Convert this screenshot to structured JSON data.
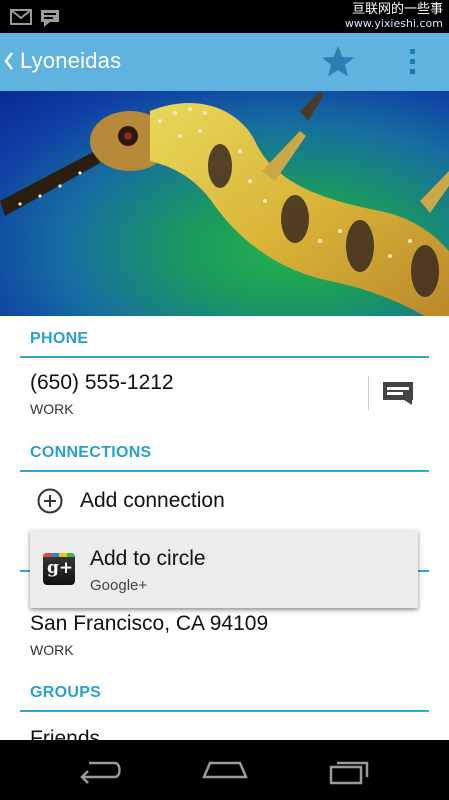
{
  "status_bar": {
    "watermark_line1": "亘联网的一些事",
    "watermark_line2": "www.yixieshi.com"
  },
  "action_bar": {
    "title": "Lyoneidas"
  },
  "phone": {
    "header": "PHONE",
    "number": "(650) 555-1212",
    "type": "WORK"
  },
  "connections": {
    "header": "CONNECTIONS",
    "add_label": "Add connection"
  },
  "popup": {
    "title": "Add to circle",
    "subtitle": "Google+"
  },
  "address": {
    "line": "San Francisco, CA 94109",
    "type": "WORK"
  },
  "groups": {
    "header": "GROUPS",
    "first": "Friends"
  },
  "colors": {
    "action_bar": "#5fb3de",
    "accent": "#2b9fd0",
    "star": "#2a7fb5"
  },
  "icons": [
    "gmail-icon",
    "message-notification-icon",
    "star-icon",
    "overflow-menu-icon",
    "message-icon",
    "add-circle-icon",
    "google-plus-icon",
    "back-icon",
    "home-icon",
    "recents-icon"
  ]
}
